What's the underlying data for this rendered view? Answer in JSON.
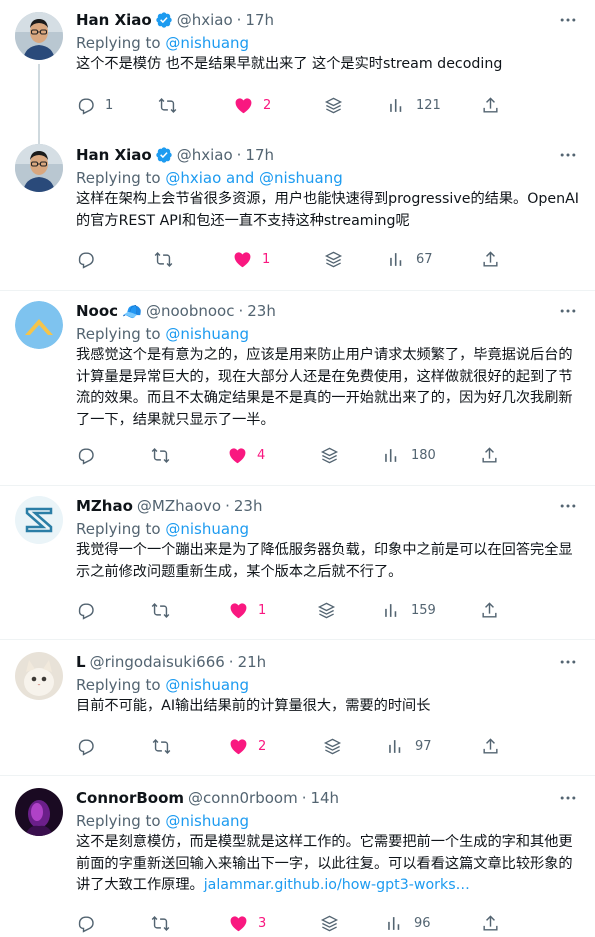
{
  "tweets": [
    {
      "name": "Han Xiao",
      "verified": true,
      "emoji": "",
      "handle": "@hxiao",
      "time": "17h",
      "replying_label": "Replying to",
      "replying_to": "@nishuang",
      "text": "这个不是模仿 也不是结果早就出来了 这个是实时stream decoding",
      "link": "",
      "replies": "1",
      "retweets": "",
      "likes": "2",
      "views": "121",
      "avatar": "man-glasses-photo",
      "liked": true
    },
    {
      "name": "Han Xiao",
      "verified": true,
      "emoji": "",
      "handle": "@hxiao",
      "time": "17h",
      "replying_label": "Replying to",
      "replying_to": "@hxiao and @nishuang",
      "text": "这样在架构上会节省很多资源，用户也能快速得到progressive的结果。OpenAI的官方REST API和包还一直不支持这种streaming呢",
      "link": "",
      "replies": "",
      "retweets": "",
      "likes": "1",
      "views": "67",
      "avatar": "man-glasses-photo",
      "liked": true
    },
    {
      "name": "Nooc",
      "verified": false,
      "emoji": "🧢",
      "handle": "@noobnooc",
      "time": "23h",
      "replying_label": "Replying to",
      "replying_to": "@nishuang",
      "text": "我感觉这个是有意为之的，应该是用来防止用户请求太频繁了，毕竟据说后台的计算量是异常巨大的，现在大部分人还是在免费使用，这样做就很好的起到了节流的效果。而且不太确定结果是不是真的一开始就出来了的，因为好几次我刷新了一下，结果就只显示了一半。",
      "link": "",
      "replies": "",
      "retweets": "",
      "likes": "4",
      "views": "180",
      "avatar": "blue-circle-mountain-logo",
      "liked": true
    },
    {
      "name": "MZhao",
      "verified": false,
      "emoji": "",
      "handle": "@MZhaovo",
      "time": "23h",
      "replying_label": "Replying to",
      "replying_to": "@nishuang",
      "text": "我觉得一个一个蹦出来是为了降低服务器负载，印象中之前是可以在回答完全显示之前修改问题重新生成，某个版本之后就不行了。",
      "link": "",
      "replies": "",
      "retweets": "",
      "likes": "1",
      "views": "159",
      "avatar": "z-logo",
      "liked": true
    },
    {
      "name": "L",
      "verified": false,
      "emoji": "",
      "handle": "@ringodaisuki666",
      "time": "21h",
      "replying_label": "Replying to",
      "replying_to": "@nishuang",
      "text": "目前不可能，AI输出结果前的计算量很大，需要的时间长",
      "link": "",
      "replies": "",
      "retweets": "",
      "likes": "2",
      "views": "97",
      "avatar": "white-cat-photo",
      "liked": true
    },
    {
      "name": "ConnorBoom",
      "verified": false,
      "emoji": "",
      "handle": "@conn0rboom",
      "time": "14h",
      "replying_label": "Replying to",
      "replying_to": "@nishuang",
      "text": "这不是刻意模仿，而是模型就是这样工作的。它需要把前一个生成的字和其他更前面的字重新送回输入来输出下一字，以此往复。可以看看这篇文章比较形象的讲了大致工作原理。",
      "link": "jalammar.github.io/how-gpt3-works…",
      "replies": "",
      "retweets": "",
      "likes": "3",
      "views": "96",
      "avatar": "purple-neon-portrait",
      "liked": true
    }
  ],
  "colors": {
    "like": "#f91880",
    "link": "#1d9bf0",
    "muted": "#536471",
    "verified": "#1d9bf0"
  }
}
